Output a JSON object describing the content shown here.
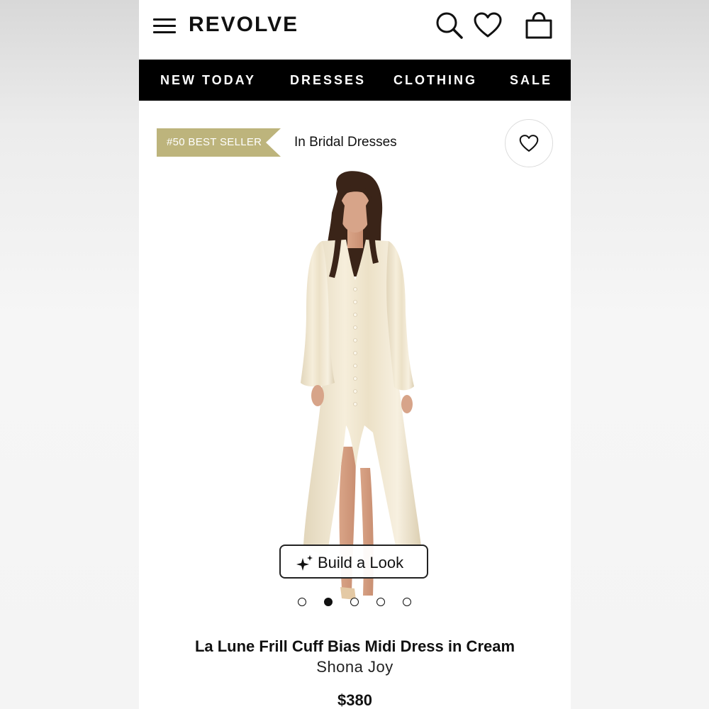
{
  "header": {
    "logo": "REVOLVE",
    "icons": [
      "menu-icon",
      "search-icon",
      "heart-icon",
      "shopping-bag-icon"
    ]
  },
  "nav": {
    "items": [
      "NEW TODAY",
      "DRESSES",
      "CLOTHING",
      "SALE"
    ]
  },
  "product": {
    "badge": "#50 BEST SELLER",
    "badge_category": "In Bridal Dresses",
    "build_look_label": "Build a Look",
    "carousel": {
      "total": 5,
      "active_index": 1
    },
    "title": "La Lune Frill Cuff Bias Midi Dress in Cream",
    "brand": "Shona Joy",
    "price": "$380"
  },
  "colors": {
    "nav_background": "#000000",
    "badge_gold": "#bdb47c",
    "dress_cream": "#f0e6cf"
  }
}
